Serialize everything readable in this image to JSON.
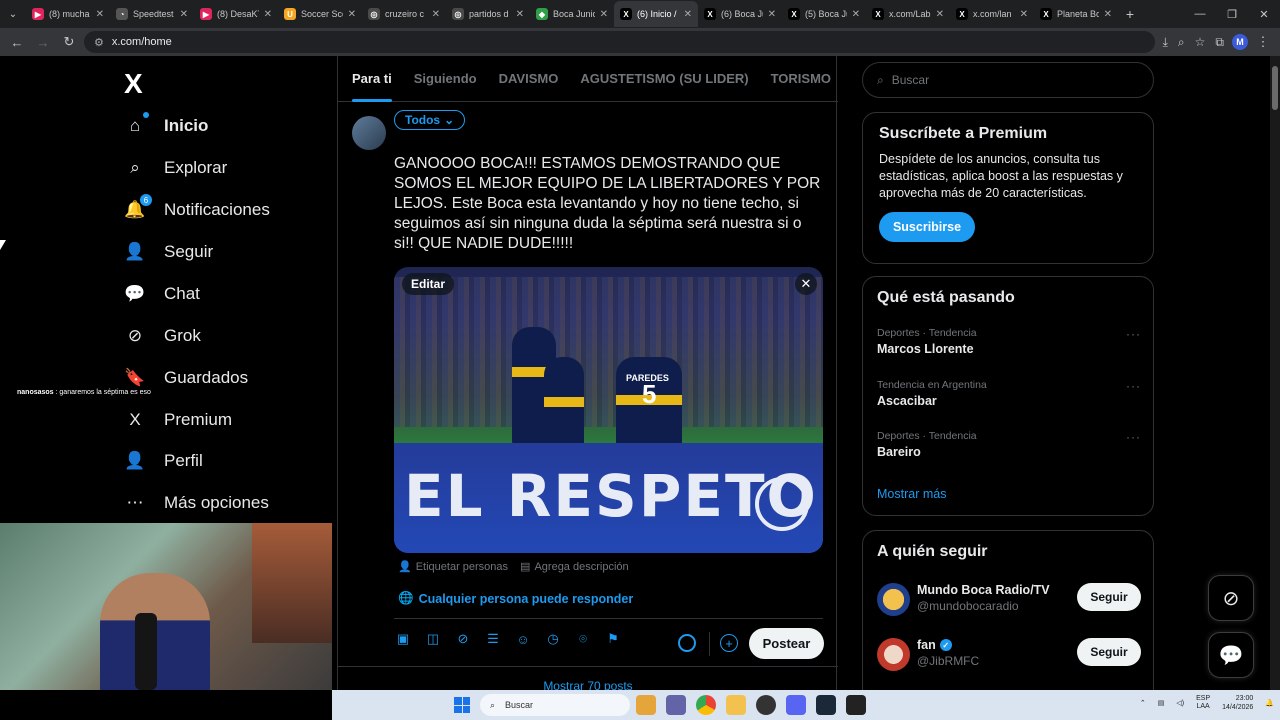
{
  "browser": {
    "tabs": [
      {
        "label": "(8) mucha",
        "color": "#e0245e",
        "glyph": "▶"
      },
      {
        "label": "Speedtest",
        "color": "#555555",
        "glyph": "◔"
      },
      {
        "label": "(8) DesaKT",
        "color": "#e0245e",
        "glyph": "▶"
      },
      {
        "label": "Soccer Sco",
        "color": "#f5a623",
        "glyph": "U"
      },
      {
        "label": "cruzeiro c",
        "color": "#4a4a4a",
        "glyph": "◎"
      },
      {
        "label": "partidos d",
        "color": "#4a4a4a",
        "glyph": "◎"
      },
      {
        "label": "Boca Junic",
        "color": "#2e9e48",
        "glyph": "◆"
      },
      {
        "label": "(6) Inicio /",
        "color": "#000000",
        "glyph": "X",
        "active": true
      },
      {
        "label": "(6) Boca Ju",
        "color": "#000000",
        "glyph": "X"
      },
      {
        "label": "(5) Boca Ju",
        "color": "#000000",
        "glyph": "X"
      },
      {
        "label": "x.com/Lab",
        "color": "#000000",
        "glyph": "X"
      },
      {
        "label": "x.com/lan",
        "color": "#000000",
        "glyph": "X"
      },
      {
        "label": "Planeta Bo",
        "color": "#000000",
        "glyph": "X"
      }
    ],
    "url": "x.com/home",
    "profile_initial": "M"
  },
  "nav": {
    "logo": "X",
    "items": [
      {
        "label": "Inicio",
        "icon": "⌂",
        "active": true,
        "dot": true
      },
      {
        "label": "Explorar",
        "icon": "⌕"
      },
      {
        "label": "Notificaciones",
        "icon": "🔔",
        "badge": "6"
      },
      {
        "label": "Seguir",
        "icon": "👤"
      },
      {
        "label": "Chat",
        "icon": "💬"
      },
      {
        "label": "Grok",
        "icon": "⊘"
      },
      {
        "label": "Guardados",
        "icon": "🔖"
      },
      {
        "label": "Premium",
        "icon": "X"
      },
      {
        "label": "Perfil",
        "icon": "👤"
      },
      {
        "label": "Más opciones",
        "icon": "⋯"
      }
    ],
    "overlay_user": "nanosasos",
    "overlay_msg": " : ganaremos la séptima es eso"
  },
  "feed": {
    "tabs": [
      "Para ti",
      "Siguiendo",
      "DAVISMO",
      "AGUSTETISMO (SU LIDER)",
      "TORISMO"
    ],
    "audience": "Todos",
    "compose_text": "GANOOOO BOCA!!! ESTAMOS DEMOSTRANDO QUE SOMOS EL MEJOR EQUIPO DE LA LIBERTADORES Y POR LEJOS. Este Boca esta levantando y hoy no tiene techo, si seguimos así sin ninguna duda la séptima será nuestra si o si!! QUE NADIE DUDE!!!!!",
    "media": {
      "edit": "Editar",
      "board_text": "EL RESPETO",
      "jersey_name": "PAREDES",
      "jersey_number": "5"
    },
    "tag_people": "Etiquetar personas",
    "add_desc": "Agrega descripción",
    "reply_setting": "Cualquier persona puede responder",
    "post_button": "Postear",
    "show_posts": "Mostrar 70 posts"
  },
  "right": {
    "search_placeholder": "Buscar",
    "premium": {
      "title": "Suscríbete a Premium",
      "desc": "Despídete de los anuncios, consulta tus estadísticas, aplica boost a las respuestas y aprovecha más de 20 características.",
      "button": "Suscribirse"
    },
    "trends": {
      "title": "Qué está pasando",
      "items": [
        {
          "category": "Deportes · Tendencia",
          "name": "Marcos Llorente"
        },
        {
          "category": "Tendencia en Argentina",
          "name": "Ascacibar"
        },
        {
          "category": "Deportes · Tendencia",
          "name": "Bareiro"
        }
      ],
      "more": "Mostrar más"
    },
    "follow": {
      "title": "A quién seguir",
      "users": [
        {
          "name": "Mundo Boca Radio/TV",
          "handle": "@mundobocaradio",
          "button": "Seguir",
          "verified": false
        },
        {
          "name": "fan",
          "handle": "@JibRMFC",
          "button": "Seguir",
          "verified": true
        }
      ]
    }
  },
  "taskbar": {
    "search": "Buscar",
    "lang1": "ESP",
    "lang2": "LAA",
    "time": "23:00",
    "date": "14/4/2026"
  }
}
